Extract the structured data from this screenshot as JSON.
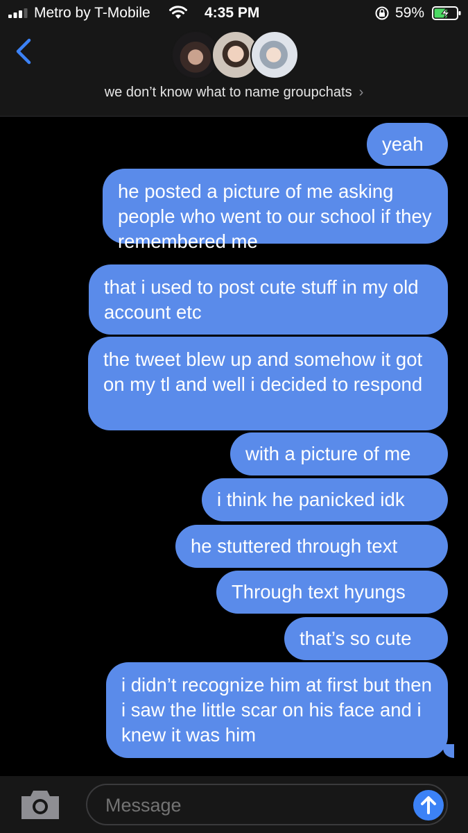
{
  "status_bar": {
    "carrier": "Metro by T-Mobile",
    "time": "4:35 PM",
    "battery_percent": "59%",
    "battery_level": 0.59,
    "signal_bars": 3
  },
  "header": {
    "back_icon": "chevron-left-icon",
    "group_name": "we don’t know what to name groupchats",
    "group_chevron": "›",
    "avatar_count": 3
  },
  "messages": [
    {
      "text": "yeah",
      "sender": "me"
    },
    {
      "text": "he posted a picture of me asking people who went to our school if they remembered me",
      "sender": "me"
    },
    {
      "text": "that i used to post cute stuff in my old account etc",
      "sender": "me"
    },
    {
      "text": "the tweet blew up and somehow it got on my tl and well i decided to respond",
      "sender": "me"
    },
    {
      "text": "with a picture of me",
      "sender": "me"
    },
    {
      "text": "i think he panicked idk",
      "sender": "me"
    },
    {
      "text": "he stuttered through text",
      "sender": "me"
    },
    {
      "text": "Through text hyungs",
      "sender": "me"
    },
    {
      "text": "that’s so cute",
      "sender": "me"
    },
    {
      "text": "i didn’t recognize him at first but then i saw the little scar on his face and i knew it was him",
      "sender": "me"
    }
  ],
  "input": {
    "placeholder": "Message",
    "value": ""
  },
  "colors": {
    "bubble": "#5a8bea",
    "accent": "#3c82f6",
    "background": "#000000",
    "bar": "#171717"
  }
}
